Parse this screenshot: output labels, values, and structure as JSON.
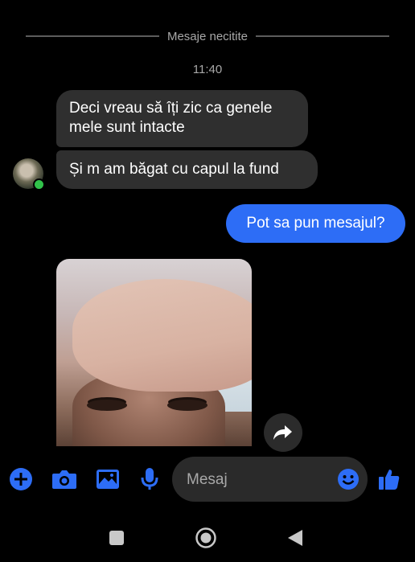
{
  "divider": {
    "label": "Mesaje necitite"
  },
  "timestamp": "11:40",
  "messages": {
    "incoming": [
      {
        "text": "Deci vreau să îți zic ca genele mele sunt intacte"
      },
      {
        "text": "Și m am băgat cu capul la fund"
      }
    ],
    "outgoing": [
      {
        "text": "Pot sa pun mesajul?"
      }
    ]
  },
  "composer": {
    "placeholder": "Mesaj",
    "accent": "#2d6df6"
  },
  "colors": {
    "bubble_in": "#2f2f2f",
    "bubble_out": "#2d6df6",
    "background": "#000000"
  },
  "icons": [
    "plus-icon",
    "camera-icon",
    "image-icon",
    "microphone-icon",
    "emoji-icon",
    "thumbs-up-icon",
    "share-icon",
    "nav-recents-icon",
    "nav-home-icon",
    "nav-back-icon"
  ]
}
